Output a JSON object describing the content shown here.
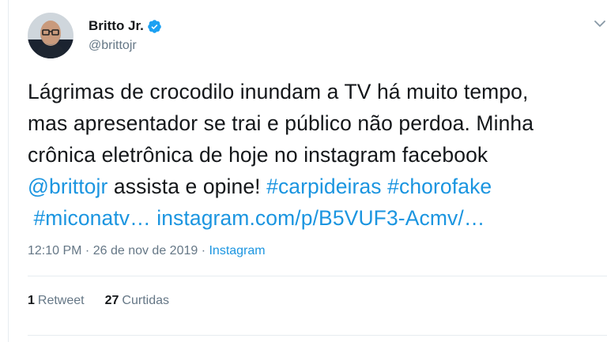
{
  "author": {
    "display_name": "Britto Jr.",
    "handle": "@brittojr",
    "verified_icon": "verified-badge-icon",
    "verified_color": "#1da1f2"
  },
  "tweet": {
    "lines": [
      [
        {
          "t": "Lágrimas de crocodilo inundam a TV há muito tempo,",
          "link": false
        }
      ],
      [
        {
          "t": "mas apresentador se trai e público não perdoa. Minha",
          "link": false
        }
      ],
      [
        {
          "t": "crônica eletrônica de hoje no instagram facebook",
          "link": false
        }
      ],
      [
        {
          "t": "@brittojr",
          "link": true
        },
        {
          "t": " assista e opine! ",
          "link": false
        },
        {
          "t": "#carpideiras",
          "link": true
        },
        {
          "t": " ",
          "link": false
        },
        {
          "t": "#chorofake",
          "link": true
        }
      ],
      [
        {
          "t": " #miconatv…",
          "link": true
        },
        {
          "t": " ",
          "link": false
        },
        {
          "t": "instagram.com/p/B5VUF3-Acmv/…",
          "link": true
        }
      ]
    ]
  },
  "meta": {
    "time": "12:10 PM",
    "separator1": " · ",
    "date": "26 de nov de 2019",
    "separator2": " · ",
    "source": "Instagram"
  },
  "stats": {
    "retweets_count": "1",
    "retweets_label": "Retweet",
    "likes_count": "27",
    "likes_label": "Curtidas"
  },
  "colors": {
    "link": "#1b95e0",
    "text": "#14171a",
    "secondary": "#657786",
    "border": "#e6ecf0"
  },
  "icons": {
    "menu": "chevron-down-icon",
    "verified": "verified-badge-icon"
  }
}
